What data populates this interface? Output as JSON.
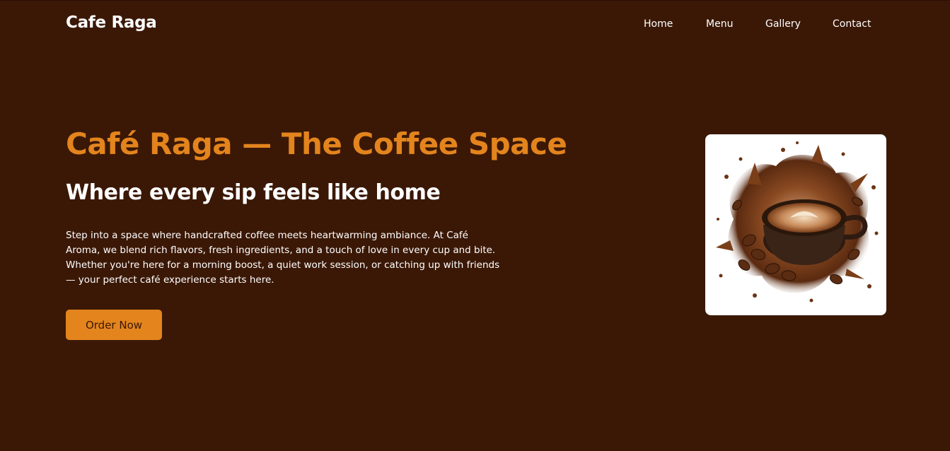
{
  "navbar": {
    "brand": "Cafe Raga",
    "links": [
      {
        "label": "Home"
      },
      {
        "label": "Menu"
      },
      {
        "label": "Gallery"
      },
      {
        "label": "Contact"
      }
    ]
  },
  "hero": {
    "title": "Café Raga — The Coffee Space",
    "subtitle": "Where every sip feels like home",
    "description": "Step into a space where handcrafted coffee meets heartwarming ambiance. At Café Aroma, we blend rich flavors, fresh ingredients, and a touch of love in every cup and bite. Whether you're here for a morning boost, a quiet work session, or catching up with friends — your perfect café experience starts here.",
    "cta_label": "Order Now"
  },
  "colors": {
    "background": "#3b1806",
    "accent": "#e3841d",
    "text": "#ffffff"
  },
  "icons": {
    "hero_image": "coffee-splash-image"
  }
}
